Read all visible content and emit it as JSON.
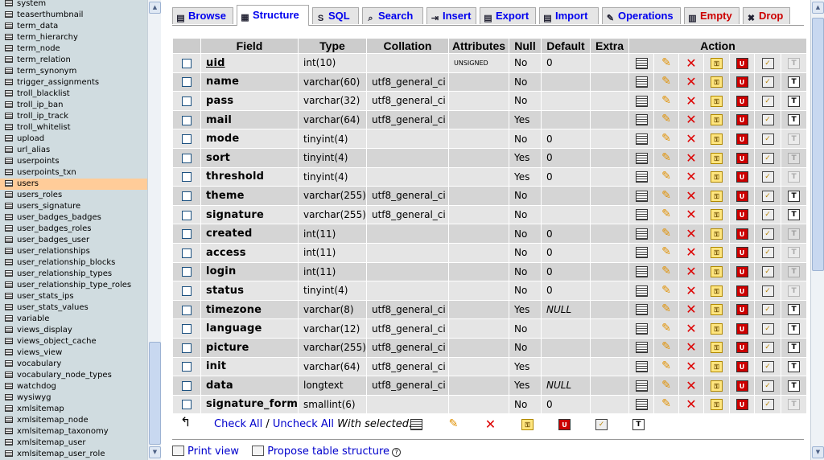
{
  "nav": {
    "tables": [
      "system",
      "teaserthumbnail",
      "term_data",
      "term_hierarchy",
      "term_node",
      "term_relation",
      "term_synonym",
      "trigger_assignments",
      "troll_blacklist",
      "troll_ip_ban",
      "troll_ip_track",
      "troll_whitelist",
      "upload",
      "url_alias",
      "userpoints",
      "userpoints_txn",
      "users",
      "users_roles",
      "users_signature",
      "user_badges_badges",
      "user_badges_roles",
      "user_badges_user",
      "user_relationships",
      "user_relationship_blocks",
      "user_relationship_types",
      "user_relationship_type_roles",
      "user_stats_ips",
      "user_stats_values",
      "variable",
      "views_display",
      "views_object_cache",
      "views_view",
      "vocabulary",
      "vocabulary_node_types",
      "watchdog",
      "wysiwyg",
      "xmlsitemap",
      "xmlsitemap_node",
      "xmlsitemap_taxonomy",
      "xmlsitemap_user",
      "xmlsitemap_user_role"
    ],
    "active": "users"
  },
  "tabs": [
    {
      "label": "Browse",
      "icon": "browse-icon",
      "active": false,
      "danger": false
    },
    {
      "label": "Structure",
      "icon": "structure-icon",
      "active": true,
      "danger": false
    },
    {
      "label": "SQL",
      "icon": "sql-icon",
      "active": false,
      "danger": false
    },
    {
      "label": "Search",
      "icon": "search-icon",
      "active": false,
      "danger": false
    },
    {
      "label": "Insert",
      "icon": "insert-icon",
      "active": false,
      "danger": false
    },
    {
      "label": "Export",
      "icon": "export-icon",
      "active": false,
      "danger": false
    },
    {
      "label": "Import",
      "icon": "import-icon",
      "active": false,
      "danger": false
    },
    {
      "label": "Operations",
      "icon": "operations-icon",
      "active": false,
      "danger": false
    },
    {
      "label": "Empty",
      "icon": "empty-icon",
      "active": false,
      "danger": true
    },
    {
      "label": "Drop",
      "icon": "drop-icon",
      "active": false,
      "danger": true
    }
  ],
  "table": {
    "headers": {
      "field": "Field",
      "type": "Type",
      "collation": "Collation",
      "attributes": "Attributes",
      "null": "Null",
      "default": "Default",
      "extra": "Extra",
      "action": "Action"
    },
    "rows": [
      {
        "field": "uid",
        "type": "int(10)",
        "collation": "",
        "attributes": "UNSIGNED",
        "null": "No",
        "default": "0",
        "extra": "",
        "primary": true,
        "fulltext": false
      },
      {
        "field": "name",
        "type": "varchar(60)",
        "collation": "utf8_general_ci",
        "attributes": "",
        "null": "No",
        "default": "",
        "extra": "",
        "primary": false,
        "fulltext": true
      },
      {
        "field": "pass",
        "type": "varchar(32)",
        "collation": "utf8_general_ci",
        "attributes": "",
        "null": "No",
        "default": "",
        "extra": "",
        "primary": false,
        "fulltext": true
      },
      {
        "field": "mail",
        "type": "varchar(64)",
        "collation": "utf8_general_ci",
        "attributes": "",
        "null": "Yes",
        "default": "",
        "extra": "",
        "primary": false,
        "fulltext": true
      },
      {
        "field": "mode",
        "type": "tinyint(4)",
        "collation": "",
        "attributes": "",
        "null": "No",
        "default": "0",
        "extra": "",
        "primary": false,
        "fulltext": false
      },
      {
        "field": "sort",
        "type": "tinyint(4)",
        "collation": "",
        "attributes": "",
        "null": "Yes",
        "default": "0",
        "extra": "",
        "primary": false,
        "fulltext": false
      },
      {
        "field": "threshold",
        "type": "tinyint(4)",
        "collation": "",
        "attributes": "",
        "null": "Yes",
        "default": "0",
        "extra": "",
        "primary": false,
        "fulltext": false
      },
      {
        "field": "theme",
        "type": "varchar(255)",
        "collation": "utf8_general_ci",
        "attributes": "",
        "null": "No",
        "default": "",
        "extra": "",
        "primary": false,
        "fulltext": true
      },
      {
        "field": "signature",
        "type": "varchar(255)",
        "collation": "utf8_general_ci",
        "attributes": "",
        "null": "No",
        "default": "",
        "extra": "",
        "primary": false,
        "fulltext": true
      },
      {
        "field": "created",
        "type": "int(11)",
        "collation": "",
        "attributes": "",
        "null": "No",
        "default": "0",
        "extra": "",
        "primary": false,
        "fulltext": false
      },
      {
        "field": "access",
        "type": "int(11)",
        "collation": "",
        "attributes": "",
        "null": "No",
        "default": "0",
        "extra": "",
        "primary": false,
        "fulltext": false
      },
      {
        "field": "login",
        "type": "int(11)",
        "collation": "",
        "attributes": "",
        "null": "No",
        "default": "0",
        "extra": "",
        "primary": false,
        "fulltext": false
      },
      {
        "field": "status",
        "type": "tinyint(4)",
        "collation": "",
        "attributes": "",
        "null": "No",
        "default": "0",
        "extra": "",
        "primary": false,
        "fulltext": false
      },
      {
        "field": "timezone",
        "type": "varchar(8)",
        "collation": "utf8_general_ci",
        "attributes": "",
        "null": "Yes",
        "default": "NULL",
        "extra": "",
        "primary": false,
        "fulltext": true
      },
      {
        "field": "language",
        "type": "varchar(12)",
        "collation": "utf8_general_ci",
        "attributes": "",
        "null": "No",
        "default": "",
        "extra": "",
        "primary": false,
        "fulltext": true
      },
      {
        "field": "picture",
        "type": "varchar(255)",
        "collation": "utf8_general_ci",
        "attributes": "",
        "null": "No",
        "default": "",
        "extra": "",
        "primary": false,
        "fulltext": true
      },
      {
        "field": "init",
        "type": "varchar(64)",
        "collation": "utf8_general_ci",
        "attributes": "",
        "null": "Yes",
        "default": "",
        "extra": "",
        "primary": false,
        "fulltext": true
      },
      {
        "field": "data",
        "type": "longtext",
        "collation": "utf8_general_ci",
        "attributes": "",
        "null": "Yes",
        "default": "NULL",
        "extra": "",
        "primary": false,
        "fulltext": true
      },
      {
        "field": "signature_format",
        "type": "smallint(6)",
        "collation": "",
        "attributes": "",
        "null": "No",
        "default": "0",
        "extra": "",
        "primary": false,
        "fulltext": false
      }
    ]
  },
  "actions": {
    "icons": [
      "browse-icon",
      "edit-icon",
      "drop-icon",
      "primary-key-icon",
      "unique-icon",
      "index-icon",
      "fulltext-icon"
    ]
  },
  "selection": {
    "check_all": "Check All",
    "separator": "/",
    "uncheck_all": "Uncheck All",
    "with_selected": "With selected:"
  },
  "footer": {
    "print_view": "Print view",
    "propose": "Propose table structure"
  },
  "colors": {
    "nav_bg": "#d0dce0",
    "nav_active": "#ffcc99",
    "header_bg": "#cccccc",
    "row_odd": "#e5e5e5",
    "row_even": "#d5d5d5",
    "link": "#0000cc",
    "danger": "#cc0000"
  }
}
